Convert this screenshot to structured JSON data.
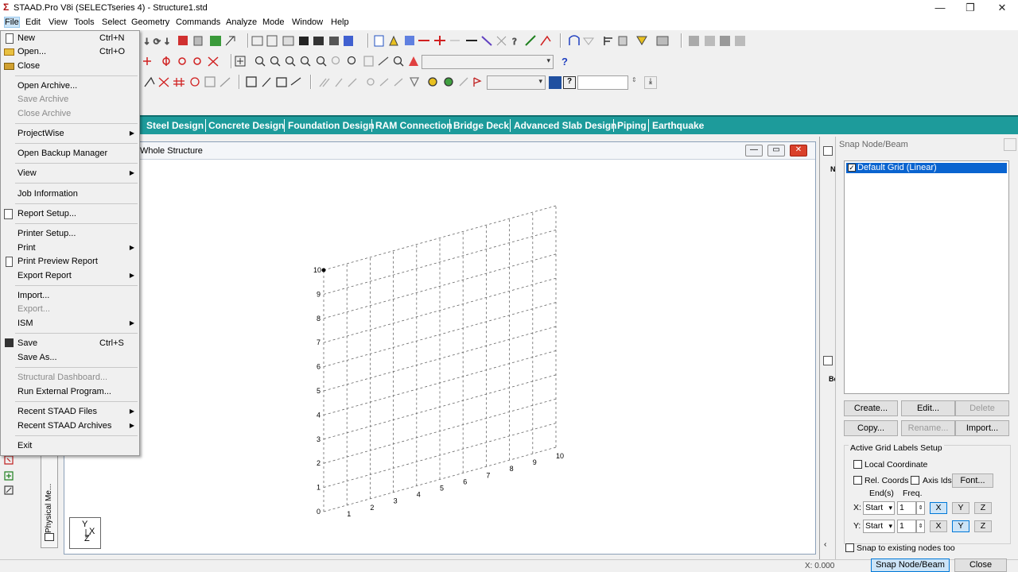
{
  "window": {
    "title": "STAAD.Pro V8i (SELECTseries 4) - Structure1.std"
  },
  "menubar": [
    "File",
    "Edit",
    "View",
    "Tools",
    "Select",
    "Geometry",
    "Commands",
    "Analyze",
    "Mode",
    "Window",
    "Help"
  ],
  "file_menu": {
    "items": [
      {
        "label": "New",
        "shortcut": "Ctrl+N"
      },
      {
        "label": "Open...",
        "shortcut": "Ctrl+O"
      },
      {
        "label": "Close"
      },
      {
        "label": "Open Archive..."
      },
      {
        "label": "Save Archive"
      },
      {
        "label": "Close Archive"
      },
      {
        "label": "ProjectWise"
      },
      {
        "label": "Open Backup Manager"
      },
      {
        "label": "View"
      },
      {
        "label": "Job Information"
      },
      {
        "label": "Report Setup..."
      },
      {
        "label": "Printer Setup..."
      },
      {
        "label": "Print"
      },
      {
        "label": "Print Preview Report"
      },
      {
        "label": "Export Report"
      },
      {
        "label": "Import..."
      },
      {
        "label": "Export..."
      },
      {
        "label": "ISM"
      },
      {
        "label": "Save",
        "shortcut": "Ctrl+S"
      },
      {
        "label": "Save As..."
      },
      {
        "label": "Structural Dashboard..."
      },
      {
        "label": "Run External Program..."
      },
      {
        "label": "Recent STAAD Files"
      },
      {
        "label": "Recent STAAD Archives"
      },
      {
        "label": "Exit"
      }
    ]
  },
  "workflow_tabs": [
    "Steel Design",
    "Concrete Design",
    "Foundation Design",
    "RAM Connection",
    "Bridge Deck",
    "Advanced Slab Design",
    "Piping",
    "Earthquake"
  ],
  "viewport": {
    "title": "Whole Structure",
    "y_labels": [
      "0",
      "1",
      "2",
      "3",
      "4",
      "5",
      "6",
      "7",
      "8",
      "9",
      "10"
    ],
    "x_labels": [
      "1",
      "2",
      "3",
      "4",
      "5",
      "6",
      "7",
      "8",
      "9",
      "10"
    ],
    "axis_y": "Y",
    "axis_x": "X",
    "axis_z": "Z"
  },
  "left_tab": {
    "label": "Physical Me..."
  },
  "mid_strip": {
    "top_label": "N",
    "bottom_label": "Be"
  },
  "snap_panel": {
    "title": "Snap Node/Beam",
    "grid_item": "Default Grid (Linear)",
    "buttons": [
      "Create...",
      "Edit...",
      "Delete",
      "Copy...",
      "Rename...",
      "Import..."
    ],
    "group_title": "Active Grid Labels Setup",
    "local_coordinate": "Local Coordinate",
    "rel_coords": "Rel. Coords",
    "axis_ids": "Axis Ids",
    "font_button": "Font...",
    "ends_label": "End(s)",
    "freq_label": "Freq.",
    "x_row": {
      "label": "X:",
      "end": "Start",
      "freq": "1"
    },
    "y_row": {
      "label": "Y:",
      "end": "Start",
      "freq": "1"
    },
    "axis_buttons": [
      "X",
      "Y",
      "Z"
    ],
    "snap_existing": "Snap to existing nodes too"
  },
  "statusbar": {
    "coord": "X: 0.000",
    "snap_button": "Snap Node/Beam",
    "close_button": "Close"
  }
}
